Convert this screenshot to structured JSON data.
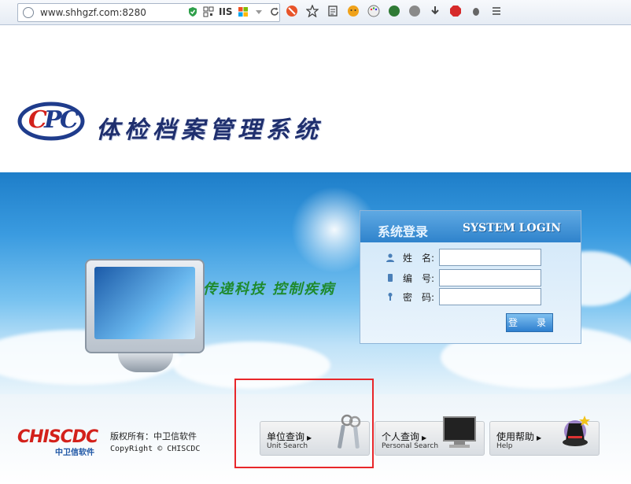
{
  "browser": {
    "url": "www.shhgzf.com:8280",
    "iis_badge": "IIS"
  },
  "header": {
    "system_title": "体检档案管理系统"
  },
  "banner": {
    "slogan": "传递科技  控制疾病"
  },
  "login": {
    "title_cn": "系统登录",
    "title_en": "SYSTEM LOGIN",
    "fields": [
      {
        "label": "姓　名:",
        "value": ""
      },
      {
        "label": "编　号:",
        "value": ""
      },
      {
        "label": "密　码:",
        "value": ""
      }
    ],
    "button_label": "登　录"
  },
  "footer": {
    "brand": "CHISCDC",
    "brand_sub": "中卫信软件",
    "copyright_cn": "版权所有：中卫信软件",
    "copyright_en": "CopyRight © CHISCDC",
    "nav": [
      {
        "cn": "单位查询",
        "en": "Unit Search",
        "icon": "keys-icon"
      },
      {
        "cn": "个人查询",
        "en": "Personal Search",
        "icon": "monitor-icon"
      },
      {
        "cn": "使用帮助",
        "en": "Help",
        "icon": "magic-hat-icon"
      }
    ]
  },
  "colors": {
    "highlight": "#e8262a",
    "title": "#1f2f6e",
    "slogan": "#1e8a2d",
    "brand_red": "#d3211b"
  }
}
